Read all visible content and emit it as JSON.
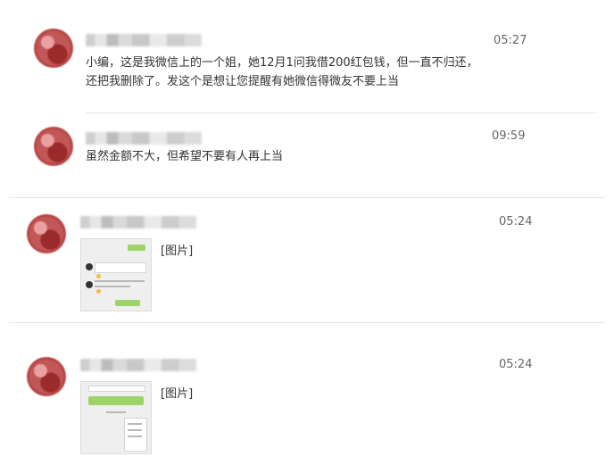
{
  "messages": [
    {
      "time": "05:27",
      "lines": [
        "小编，这是我微信上的一个姐，她12月1问我借200红包钱，但一直不归还，",
        "还把我删除了。发这个是想让您提醒有她微信得微友不要上当"
      ]
    },
    {
      "time": "09:59",
      "lines": [
        "虽然金额不大，但希望不要有人再上当"
      ]
    },
    {
      "time": "05:24",
      "image_label": "[图片]"
    },
    {
      "time": "05:24",
      "image_label": "[图片]"
    }
  ],
  "colors": {
    "avatar": "#b84848",
    "divider": "#e5e5e5",
    "bubble_green": "#9ed36a"
  }
}
